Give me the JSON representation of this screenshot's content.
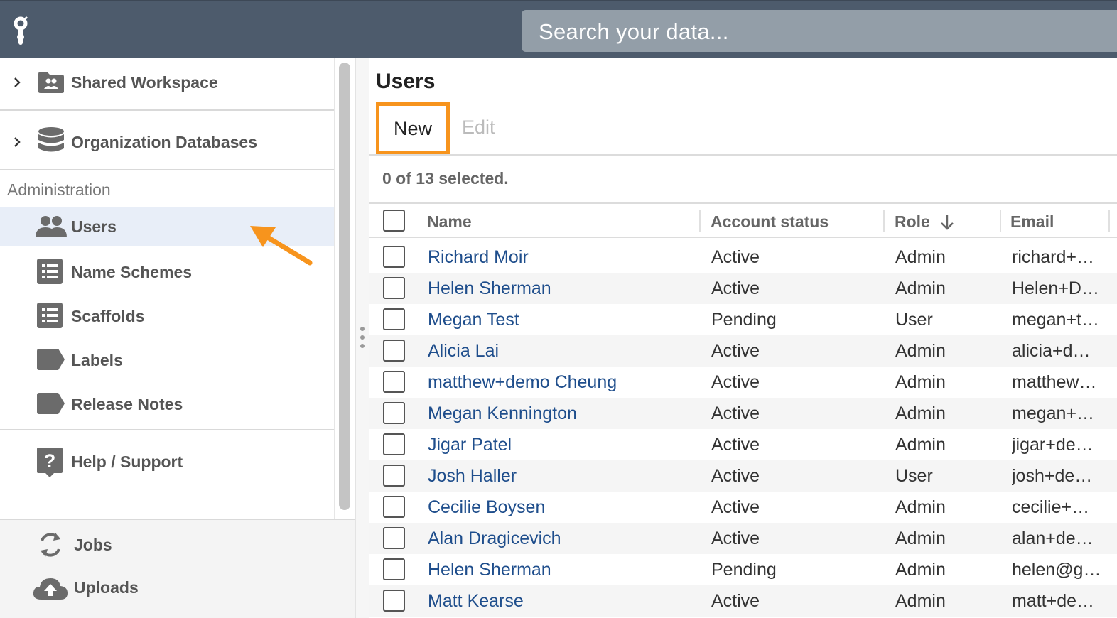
{
  "header": {
    "search_placeholder": "Search your data..."
  },
  "sidebar": {
    "shared_workspace": "Shared Workspace",
    "organization_databases": "Organization Databases",
    "section_title": "Administration",
    "items": [
      {
        "label": "Users",
        "icon": "users-icon",
        "selected": true
      },
      {
        "label": "Name Schemes",
        "icon": "list-icon",
        "selected": false
      },
      {
        "label": "Scaffolds",
        "icon": "list-icon",
        "selected": false
      },
      {
        "label": "Labels",
        "icon": "label-tag-icon",
        "selected": false
      },
      {
        "label": "Release Notes",
        "icon": "label-tag-icon",
        "selected": false
      }
    ],
    "help": "Help / Support",
    "footer": {
      "jobs": "Jobs",
      "uploads": "Uploads"
    }
  },
  "main": {
    "title": "Users",
    "new_label": "New",
    "edit_label": "Edit",
    "selected_text": "0 of 13 selected.",
    "columns": [
      "Name",
      "Account status",
      "Role",
      "Email"
    ],
    "rows": [
      {
        "name": "Richard Moir",
        "status": "Active",
        "role": "Admin",
        "email": "richard+…"
      },
      {
        "name": "Helen Sherman",
        "status": "Active",
        "role": "Admin",
        "email": "Helen+D…"
      },
      {
        "name": "Megan Test",
        "status": "Pending",
        "role": "User",
        "email": "megan+t…"
      },
      {
        "name": "Alicia Lai",
        "status": "Active",
        "role": "Admin",
        "email": "alicia+d…"
      },
      {
        "name": "matthew+demo Cheung",
        "status": "Active",
        "role": "Admin",
        "email": "matthew…"
      },
      {
        "name": "Megan Kennington",
        "status": "Active",
        "role": "Admin",
        "email": "megan+…"
      },
      {
        "name": "Jigar Patel",
        "status": "Active",
        "role": "Admin",
        "email": "jigar+de…"
      },
      {
        "name": "Josh Haller",
        "status": "Active",
        "role": "User",
        "email": "josh+de…"
      },
      {
        "name": "Cecilie Boysen",
        "status": "Active",
        "role": "Admin",
        "email": "cecilie+…"
      },
      {
        "name": "Alan Dragicevich",
        "status": "Active",
        "role": "Admin",
        "email": "alan+de…"
      },
      {
        "name": "Helen Sherman",
        "status": "Pending",
        "role": "Admin",
        "email": "helen@g…"
      },
      {
        "name": "Matt Kearse",
        "status": "Active",
        "role": "Admin",
        "email": "matt+de…"
      }
    ]
  },
  "colors": {
    "topbar": "#4d5b6c",
    "highlight": "#f7941d",
    "link": "#1f4e8c",
    "selected_bg": "#e8eef8"
  }
}
